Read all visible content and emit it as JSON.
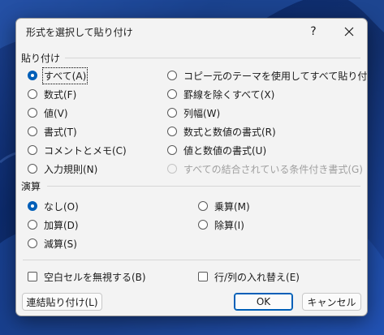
{
  "dialog": {
    "title": "形式を選択して貼り付け",
    "help_label": "?",
    "close_icon": "close-icon"
  },
  "paste": {
    "label": "貼り付け",
    "left_options": [
      {
        "label": "すべて(A)",
        "checked": true
      },
      {
        "label": "数式(F)",
        "checked": false
      },
      {
        "label": "値(V)",
        "checked": false
      },
      {
        "label": "書式(T)",
        "checked": false
      },
      {
        "label": "コメントとメモ(C)",
        "checked": false
      },
      {
        "label": "入力規則(N)",
        "checked": false
      }
    ],
    "right_options": [
      {
        "label": "コピー元のテーマを使用してすべて貼り付け(H)",
        "checked": false
      },
      {
        "label": "罫線を除くすべて(X)",
        "checked": false
      },
      {
        "label": "列幅(W)",
        "checked": false
      },
      {
        "label": "数式と数値の書式(R)",
        "checked": false
      },
      {
        "label": "値と数値の書式(U)",
        "checked": false
      },
      {
        "label": "すべての結合されている条件付き書式(G)",
        "checked": false,
        "disabled": true
      }
    ]
  },
  "operation": {
    "label": "演算",
    "left_options": [
      {
        "label": "なし(O)",
        "checked": true
      },
      {
        "label": "加算(D)",
        "checked": false
      },
      {
        "label": "減算(S)",
        "checked": false
      }
    ],
    "right_options": [
      {
        "label": "乗算(M)",
        "checked": false
      },
      {
        "label": "除算(I)",
        "checked": false
      }
    ]
  },
  "checkboxes": {
    "skip_blanks": "空白セルを無視する(B)",
    "transpose": "行/列の入れ替え(E)"
  },
  "buttons": {
    "paste_link": "連結貼り付け(L)",
    "ok": "OK",
    "cancel": "キャンセル"
  },
  "colors": {
    "accent": "#005fb8",
    "dialog_bg": "#f3f3f3"
  }
}
